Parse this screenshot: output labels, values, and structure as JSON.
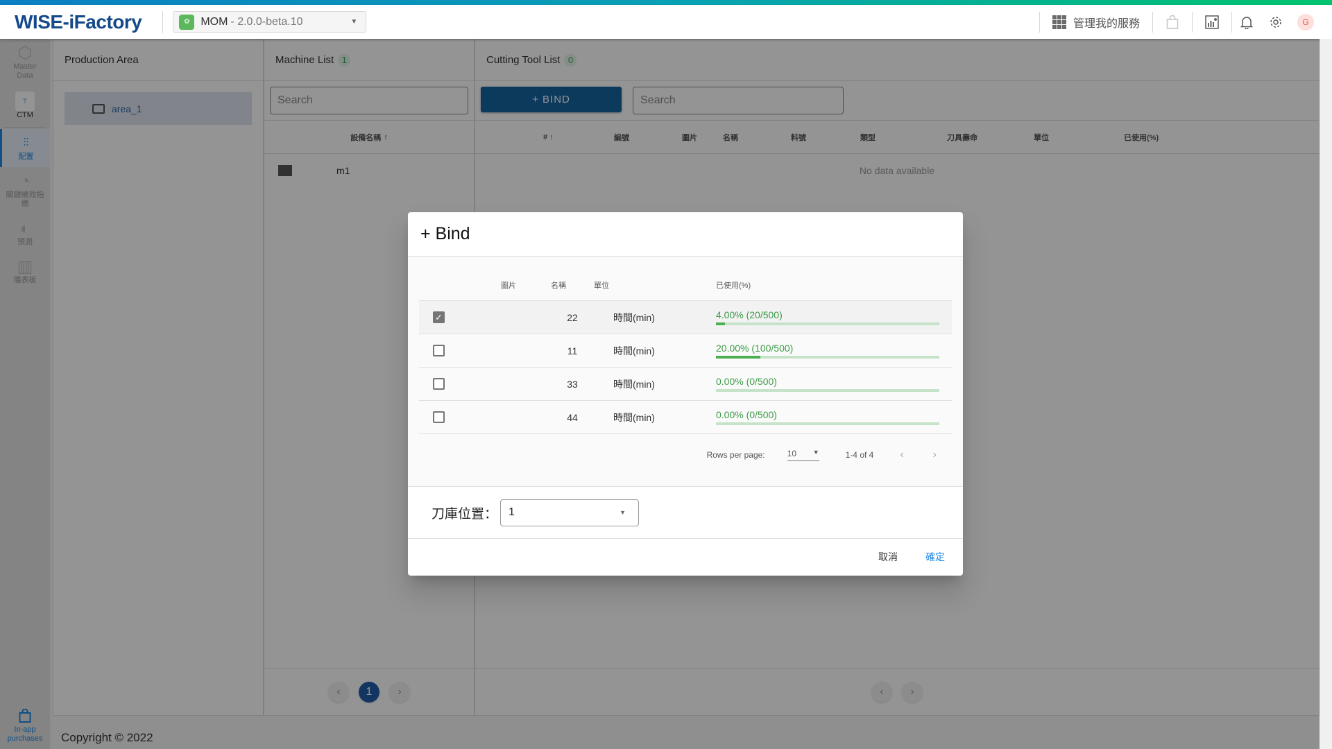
{
  "header": {
    "logo": "WISE-iFactory",
    "app_icon_label": "iFactory",
    "app_name": "MOM",
    "app_version": "- 2.0.0-beta.10",
    "manage_services": "管理我的服務",
    "avatar_initial": "G",
    "icons": [
      "apps-grid-icon",
      "shopping-bag-icon",
      "dashboard-chart-icon",
      "bell-icon",
      "gear-icon"
    ]
  },
  "leftnav": {
    "items": [
      {
        "label": "Master Data",
        "icon": "hexagon-icon",
        "active": false
      },
      {
        "label": "CTM",
        "icon": "ctm-app-icon",
        "active": false
      },
      {
        "label": "配置",
        "icon": "sliders-icon",
        "active": true
      },
      {
        "label": "關鍵績效指標",
        "icon": "gauge-icon",
        "active": false
      },
      {
        "label": "預測",
        "icon": "brain-icon",
        "active": false
      },
      {
        "label": "儀表板",
        "icon": "dashboard-icon",
        "active": false
      }
    ],
    "bottom": {
      "label": "In-app purchases",
      "icon": "shopping-bag-icon"
    }
  },
  "production_area": {
    "title": "Production Area",
    "items": [
      {
        "label": "area_1",
        "selected": true
      }
    ]
  },
  "machine_list": {
    "title": "Machine List",
    "count": "1",
    "search_placeholder": "Search",
    "column": "設備名稱",
    "rows": [
      {
        "name": "m1"
      }
    ],
    "pagination": {
      "current": "1",
      "prev": "‹",
      "next": "›"
    }
  },
  "cutting_tool_list": {
    "title": "Cutting Tool List",
    "count": "0",
    "bind_button": "+ BIND",
    "search_placeholder": "Search",
    "columns": [
      "#",
      "編號",
      "圖片",
      "名稱",
      "料號",
      "類型",
      "刀具壽命",
      "單位",
      "已使用(%)"
    ],
    "empty_text": "No data available",
    "pagination": {
      "prev": "‹",
      "next": "›"
    }
  },
  "copyright": "Copyright © 2022",
  "modal": {
    "title": "+ Bind",
    "columns": {
      "image": "圖片",
      "name": "名稱",
      "unit": "單位",
      "used": "已使用(%)"
    },
    "rows": [
      {
        "checked": true,
        "name": "22",
        "unit": "時間(min)",
        "used_label": "4.00% (20/500)",
        "used_pct": 4
      },
      {
        "checked": false,
        "name": "11",
        "unit": "時間(min)",
        "used_label": "20.00% (100/500)",
        "used_pct": 20
      },
      {
        "checked": false,
        "name": "33",
        "unit": "時間(min)",
        "used_label": "0.00% (0/500)",
        "used_pct": 0
      },
      {
        "checked": false,
        "name": "44",
        "unit": "時間(min)",
        "used_label": "0.00% (0/500)",
        "used_pct": 0
      }
    ],
    "pagination": {
      "rows_per_page_label": "Rows per page:",
      "rows_per_page": "10",
      "range": "1-4 of 4"
    },
    "slot_label": "刀庫位置：",
    "slot_value": "1",
    "cancel": "取消",
    "confirm": "確定"
  },
  "colors": {
    "accent": "#1e88e5",
    "bind_button": "#1565a0",
    "progress": "#4caf50",
    "progress_track": "#c5e3c8",
    "logo": "#154a8a"
  }
}
